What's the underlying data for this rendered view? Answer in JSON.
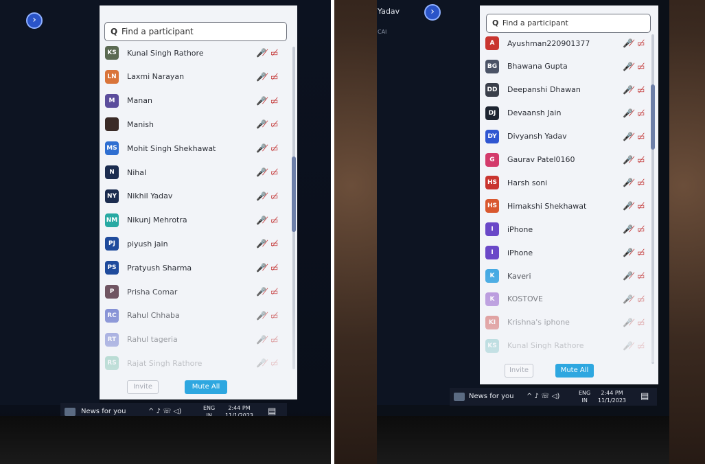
{
  "left": {
    "back_icon_glyph": "›",
    "search_placeholder": "Find a participant",
    "participants": [
      {
        "initials": "KS",
        "name": "Kunal Singh Rathore",
        "color": "#5b6a52"
      },
      {
        "initials": "LN",
        "name": "Laxmi Narayan",
        "color": "#d9743a"
      },
      {
        "initials": "M",
        "name": "Manan",
        "color": "#5b4d9c"
      },
      {
        "initials": "",
        "name": "Manish",
        "color": "#3a2a26"
      },
      {
        "initials": "MS",
        "name": "Mohit Singh Shekhawat",
        "color": "#2f6fd1"
      },
      {
        "initials": "N",
        "name": "Nihal",
        "color": "#1b2c4f"
      },
      {
        "initials": "NY",
        "name": "Nikhil Yadav",
        "color": "#1b2c4f"
      },
      {
        "initials": "NM",
        "name": "Nikunj Mehrotra",
        "color": "#27a9a3"
      },
      {
        "initials": "PJ",
        "name": "piyush jain",
        "color": "#1f4b9c"
      },
      {
        "initials": "PS",
        "name": "Pratyush Sharma",
        "color": "#1f4b9c"
      },
      {
        "initials": "P",
        "name": "Prisha Comar",
        "color": "#5b3b4a"
      },
      {
        "initials": "RC",
        "name": "Rahul Chhaba",
        "color": "#5b6ac8"
      },
      {
        "initials": "RT",
        "name": "Rahul tageria",
        "color": "#5b6ac8"
      },
      {
        "initials": "RS",
        "name": "Rajat Singh Rathore",
        "color": "#2aa07a"
      }
    ],
    "invite_label": "Invite",
    "mute_all_label": "Mute All",
    "taskbar": {
      "news_label": "News for you",
      "tray_icons": "^ ♪ ☏ ◁)",
      "lang_top": "ENG",
      "lang_bottom": "IN",
      "time": "2:44 PM",
      "date": "11/1/2023"
    }
  },
  "right": {
    "header_name": "Yadav",
    "header_sub": "CAI",
    "back_icon_glyph": "›",
    "search_placeholder": "Find a participant",
    "participants": [
      {
        "initials": "A",
        "name": "Ayushman220901377",
        "color": "#c9352f"
      },
      {
        "initials": "BG",
        "name": "Bhawana Gupta",
        "color": "#4b5366"
      },
      {
        "initials": "DD",
        "name": "Deepanshi Dhawan",
        "color": "#3a3f4a"
      },
      {
        "initials": "DJ",
        "name": "Devaansh Jain",
        "color": "#1d2430"
      },
      {
        "initials": "DY",
        "name": "Divyansh Yadav",
        "color": "#2f56d1"
      },
      {
        "initials": "G",
        "name": "Gaurav Patel0160",
        "color": "#d33b6b"
      },
      {
        "initials": "HS",
        "name": "Harsh soni",
        "color": "#c9352f"
      },
      {
        "initials": "HS",
        "name": "Himakshi Shekhawat",
        "color": "#d9582f"
      },
      {
        "initials": "I",
        "name": "iPhone",
        "color": "#6a48c8"
      },
      {
        "initials": "I",
        "name": "iPhone",
        "color": "#6a48c8"
      },
      {
        "initials": "K",
        "name": "Kaveri",
        "color": "#2a9ee0"
      },
      {
        "initials": "K",
        "name": "KOSTOVE",
        "color": "#9b6ad0"
      },
      {
        "initials": "KI",
        "name": "Krishna's iphone",
        "color": "#c9352f"
      },
      {
        "initials": "KS",
        "name": "Kunal Singh Rathore",
        "color": "#2aa0a0"
      }
    ],
    "invite_label": "Invite",
    "mute_all_label": "Mute All",
    "taskbar": {
      "news_label": "News for you",
      "tray_icons": "^ ♪ ☏ ◁)",
      "lang_top": "ENG",
      "lang_bottom": "IN",
      "time": "2:44 PM",
      "date": "11/1/2023"
    }
  },
  "status_icons": {
    "mic_muted": "🎤̸",
    "video_off": "▭̸",
    "color": "#c23030"
  }
}
